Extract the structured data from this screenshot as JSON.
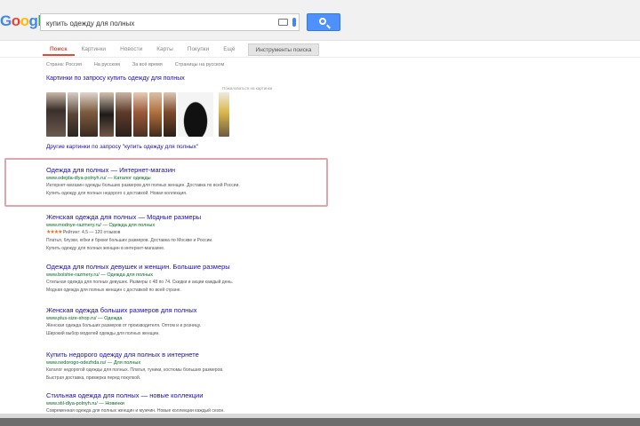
{
  "header": {
    "logo": [
      "G",
      "o",
      "o",
      "g",
      "l",
      "e"
    ],
    "search_value": "купить одежду для полных"
  },
  "tabs": [
    {
      "label": "Поиск"
    },
    {
      "label": "Картинки"
    },
    {
      "label": "Новости"
    },
    {
      "label": "Карты"
    },
    {
      "label": "Покупки"
    },
    {
      "label": "Ещё"
    },
    {
      "label": "Инструменты поиска"
    }
  ],
  "filters": [
    {
      "label": "Страна: Россия"
    },
    {
      "label": "На русском"
    },
    {
      "label": "За всё время"
    },
    {
      "label": "Страницы на русском"
    }
  ],
  "images": {
    "header": "Картинки по запросу купить одежду для полных",
    "report": "Пожаловаться на картинки",
    "more": "Другие картинки по запросу \"купить одежду для полных\""
  },
  "results": [
    {
      "title": "Одежда для полных — Интернет-магазин",
      "url": "www.odejda-dlya-polnyh.ru/ — Каталог одежды",
      "snippet1": "Интернет-магазин одежды больших размеров для полных женщин. Доставка по всей России.",
      "snippet2": "Купить одежду для полных недорого с доставкой. Новая коллекция."
    },
    {
      "title": "Женская одежда для полных — Модные размеры",
      "url": "www.modnye-razmery.ru/ — Одежда для полных",
      "rating": "★★★★",
      "rating_text": "Рейтинг: 4,5 — 120 отзывов",
      "snippet1": "Платья, блузки, юбки и брюки больших размеров. Доставка по Москве и России.",
      "snippet2": "Купить одежду для полных женщин в интернет-магазине."
    },
    {
      "title": "Одежда для полных девушек и женщин. Большие размеры",
      "url": "www.bolshie-razmery.ru/ — Одежда для полных",
      "snippet1": "Стильная одежда для полных девушек. Размеры с 48 по 74. Скидки и акции каждый день.",
      "snippet2": "Модная одежда для полных женщин с доставкой по всей стране."
    },
    {
      "title": "Женская одежда больших размеров для полных",
      "url": "www.plus-size-shop.ru/ — Одежда",
      "snippet1": "Женская одежда больших размеров от производителя. Оптом и в розницу.",
      "snippet2": "Широкий выбор моделей одежды для полных женщин."
    },
    {
      "title": "Купить недорого одежду для полных в интернете",
      "url": "www.nedorogo-odezhda.ru/ — Для полных",
      "snippet1": "Каталог недорогой одежды для полных. Платья, туники, костюмы больших размеров.",
      "snippet2": "Быстрая доставка, примерка перед покупкой."
    },
    {
      "title": "Стильная одежда для полных — новые коллекции",
      "url": "www.stil-dlya-polnyh.ru/ — Новинки",
      "snippet1": "Современная одежда для полных женщин и мужчин. Новые коллекции каждый сезон."
    }
  ],
  "colors": {
    "link": "#1a0dab",
    "url": "#006621",
    "highlight": "#e0a4aa",
    "accent": "#4d90fe"
  }
}
